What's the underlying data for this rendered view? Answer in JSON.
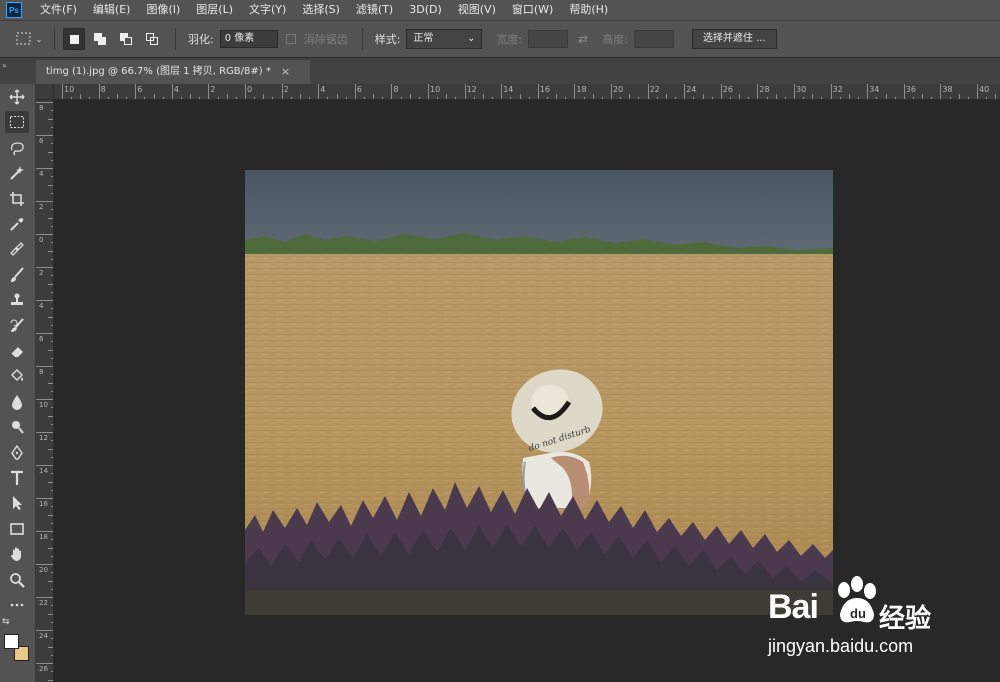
{
  "app": {
    "logo": "Ps",
    "menu": [
      "文件(F)",
      "编辑(E)",
      "图像(I)",
      "图层(L)",
      "文字(Y)",
      "选择(S)",
      "滤镜(T)",
      "3D(D)",
      "视图(V)",
      "窗口(W)",
      "帮助(H)"
    ]
  },
  "options": {
    "feather_label": "羽化:",
    "feather_value": "0 像素",
    "antialias_label": "消除锯齿",
    "style_label": "样式:",
    "style_value": "正常",
    "width_label": "宽度:",
    "height_label": "高度:",
    "select_mask_button": "选择并遮住 ..."
  },
  "document": {
    "tab_title": "timg (1).jpg @ 66.7% (图层 1 拷贝, RGB/8#) *",
    "close_glyph": "×",
    "zoom_percent": 66.7
  },
  "rulers": {
    "horizontal": [
      "10",
      "8",
      "6",
      "4",
      "2",
      "0",
      "2",
      "4",
      "6",
      "8",
      "10",
      "12",
      "14",
      "16",
      "18",
      "20",
      "22",
      "24",
      "26",
      "28",
      "30",
      "32",
      "34",
      "36",
      "38",
      "40"
    ],
    "vertical": [
      "8",
      "6",
      "4",
      "2",
      "0",
      "2",
      "4",
      "6",
      "8",
      "10",
      "12",
      "14",
      "16",
      "18",
      "20",
      "22",
      "24",
      "26"
    ]
  },
  "tools": [
    {
      "name": "move-tool",
      "active": false
    },
    {
      "name": "rectangular-marquee-tool",
      "active": true
    },
    {
      "name": "lasso-tool",
      "active": false
    },
    {
      "name": "magic-wand-tool",
      "active": false
    },
    {
      "name": "crop-tool",
      "active": false
    },
    {
      "name": "eyedropper-tool",
      "active": false
    },
    {
      "name": "healing-brush-tool",
      "active": false
    },
    {
      "name": "brush-tool",
      "active": false
    },
    {
      "name": "clone-stamp-tool",
      "active": false
    },
    {
      "name": "history-brush-tool",
      "active": false
    },
    {
      "name": "eraser-tool",
      "active": false
    },
    {
      "name": "paint-bucket-tool",
      "active": false
    },
    {
      "name": "blur-tool",
      "active": false
    },
    {
      "name": "dodge-tool",
      "active": false
    },
    {
      "name": "pen-tool",
      "active": false
    },
    {
      "name": "type-tool",
      "active": false
    },
    {
      "name": "path-selection-tool",
      "active": false
    },
    {
      "name": "rectangle-tool",
      "active": false
    },
    {
      "name": "hand-tool",
      "active": false
    },
    {
      "name": "zoom-tool",
      "active": false
    },
    {
      "name": "more-tools",
      "active": false
    }
  ],
  "colors": {
    "foreground": "#ffffff",
    "background": "#e8c98a",
    "ui_dark": "#282828",
    "ui_panel": "#535353",
    "accent": "#31a8ff"
  },
  "photo": {
    "hat_text": "do not disturb"
  },
  "watermark": {
    "brand": "Bai",
    "brand_suffix": "du",
    "chinese": "经验",
    "url": "jingyan.baidu.com"
  }
}
